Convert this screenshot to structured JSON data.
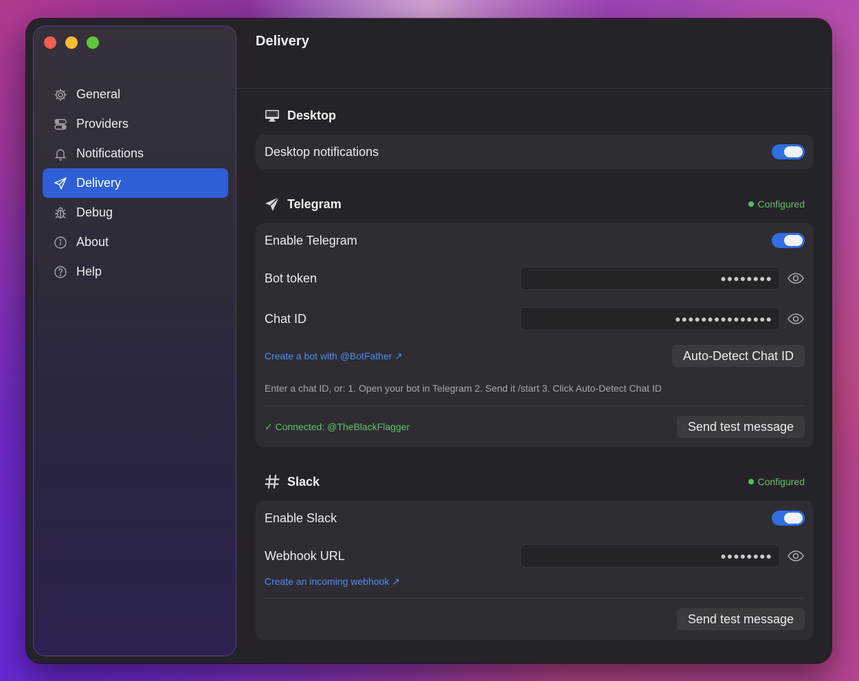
{
  "sidebar": {
    "items": [
      {
        "label": "General",
        "icon": "gear-icon"
      },
      {
        "label": "Providers",
        "icon": "toggles-icon"
      },
      {
        "label": "Notifications",
        "icon": "bell-icon"
      },
      {
        "label": "Delivery",
        "icon": "paper-plane-icon",
        "active": true
      },
      {
        "label": "Debug",
        "icon": "bug-icon"
      },
      {
        "label": "About",
        "icon": "info-icon"
      },
      {
        "label": "Help",
        "icon": "question-icon"
      }
    ]
  },
  "main": {
    "title": "Delivery",
    "desktop": {
      "title": "Desktop",
      "notifications_label": "Desktop notifications",
      "notifications_enabled": true
    },
    "telegram": {
      "title": "Telegram",
      "status": "Configured",
      "enable_label": "Enable Telegram",
      "enabled": true,
      "bot_token_label": "Bot token",
      "bot_token_value": "●●●●●●●●",
      "chat_id_label": "Chat ID",
      "chat_id_value": "●●●●●●●●●●●●●●●",
      "create_bot_link": "Create a bot with @BotFather ↗",
      "auto_detect_button": "Auto-Detect Chat ID",
      "hint": "Enter a chat ID, or: 1. Open your bot in Telegram  2. Send it /start  3. Click Auto-Detect Chat ID",
      "connected_text": "✓ Connected: @TheBlackFlagger",
      "test_button": "Send test message"
    },
    "slack": {
      "title": "Slack",
      "status": "Configured",
      "enable_label": "Enable Slack",
      "enabled": true,
      "webhook_label": "Webhook URL",
      "webhook_value": "●●●●●●●●",
      "create_webhook_link": "Create an incoming webhook ↗",
      "test_button": "Send test message"
    }
  },
  "colors": {
    "accent": "#2e5fd6",
    "toggle_on": "#2f6fe0",
    "configured": "#4ec25a",
    "link": "#4e8ef2"
  }
}
